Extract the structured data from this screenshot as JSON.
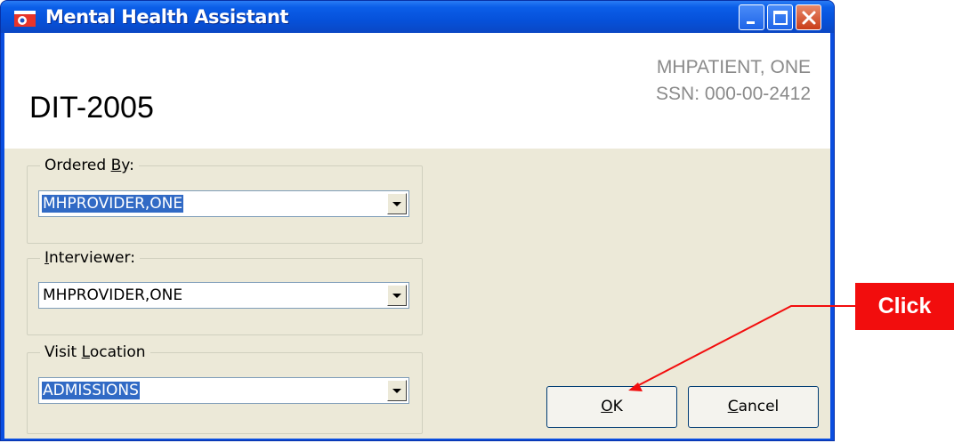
{
  "window": {
    "title": "Mental Health Assistant"
  },
  "header": {
    "instrument": "DIT-2005",
    "patient_name": "MHPATIENT, ONE",
    "patient_ssn": "SSN: 000-00-2412"
  },
  "ordered_by": {
    "label": "Ordered By:",
    "value": "MHPROVIDER,ONE"
  },
  "interviewer": {
    "label": "Interviewer:",
    "value": "MHPROVIDER,ONE"
  },
  "visit_location": {
    "label": "Visit Location",
    "value": "ADMISSIONS"
  },
  "buttons": {
    "ok": "OK",
    "cancel": "Cancel"
  },
  "callout": {
    "text": "Click"
  },
  "icons": {
    "minimize": "minimize-icon",
    "maximize": "maximize-icon",
    "close": "close-icon",
    "dropdown": "chevron-down-icon"
  },
  "colors": {
    "titlebar": "#0b5ee8",
    "callout": "#f20d0d",
    "selection": "#316ac5"
  }
}
